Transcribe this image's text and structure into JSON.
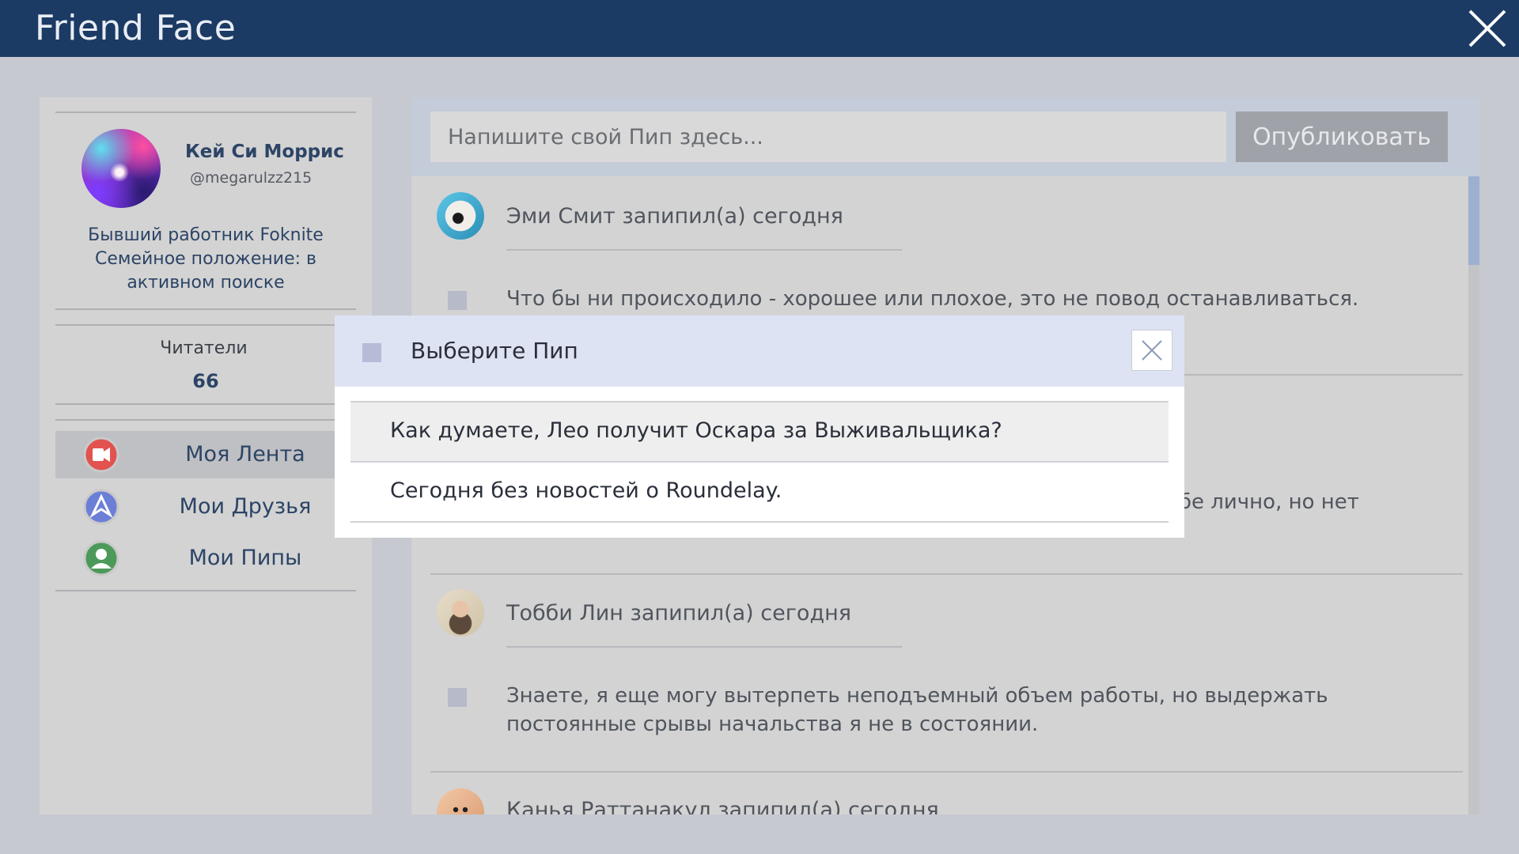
{
  "app": {
    "title": "Friend Face",
    "close_icon": "close-icon"
  },
  "profile": {
    "name": "Кей Си Моррис",
    "handle": "@megarulzz215",
    "bio_line1": "Бывший работник Foknite",
    "bio_line2": "Семейное положение: в",
    "bio_line3": "активном поиске",
    "followers_label": "Читатели",
    "followers_count": "66"
  },
  "nav": {
    "items": [
      {
        "label": "Моя Лента",
        "icon": "feed-icon",
        "active": true
      },
      {
        "label": "Мои Друзья",
        "icon": "friends-icon",
        "active": false
      },
      {
        "label": "Мои Пипы",
        "icon": "user-icon",
        "active": false
      }
    ]
  },
  "composer": {
    "placeholder": "Напишите свой Пип здесь...",
    "publish_label": "Опубликовать"
  },
  "feed": {
    "posts": [
      {
        "author": "Эми Смит запипил(а) сегодня",
        "text": "Что бы ни происходило - хорошее или плохое, это не повод останавливаться."
      },
      {
        "author": "",
        "text_fragment_right": "ебе лично, но нет"
      },
      {
        "author": "Тобби Лин запипил(а) сегодня",
        "text_line1": "Знаете, я еще могу вытерпеть неподъемный объем работы, но выдержать",
        "text_line2": "постоянные срывы начальства я не в состоянии."
      },
      {
        "author": "Канья Раттанакул запипил(а) сегодня"
      }
    ]
  },
  "modal": {
    "title": "Выберите Пип",
    "close_icon": "close-icon",
    "options": [
      {
        "label": "Как думаете, Лео получит Оскара за Выживальщика?"
      },
      {
        "label": "Сегодня без новостей о Roundelay."
      }
    ]
  },
  "colors": {
    "header": "#1b3a64",
    "accent_text": "#2c4466",
    "modal_header": "#dde3f3",
    "scroll_thumb": "#9cb0cf"
  }
}
